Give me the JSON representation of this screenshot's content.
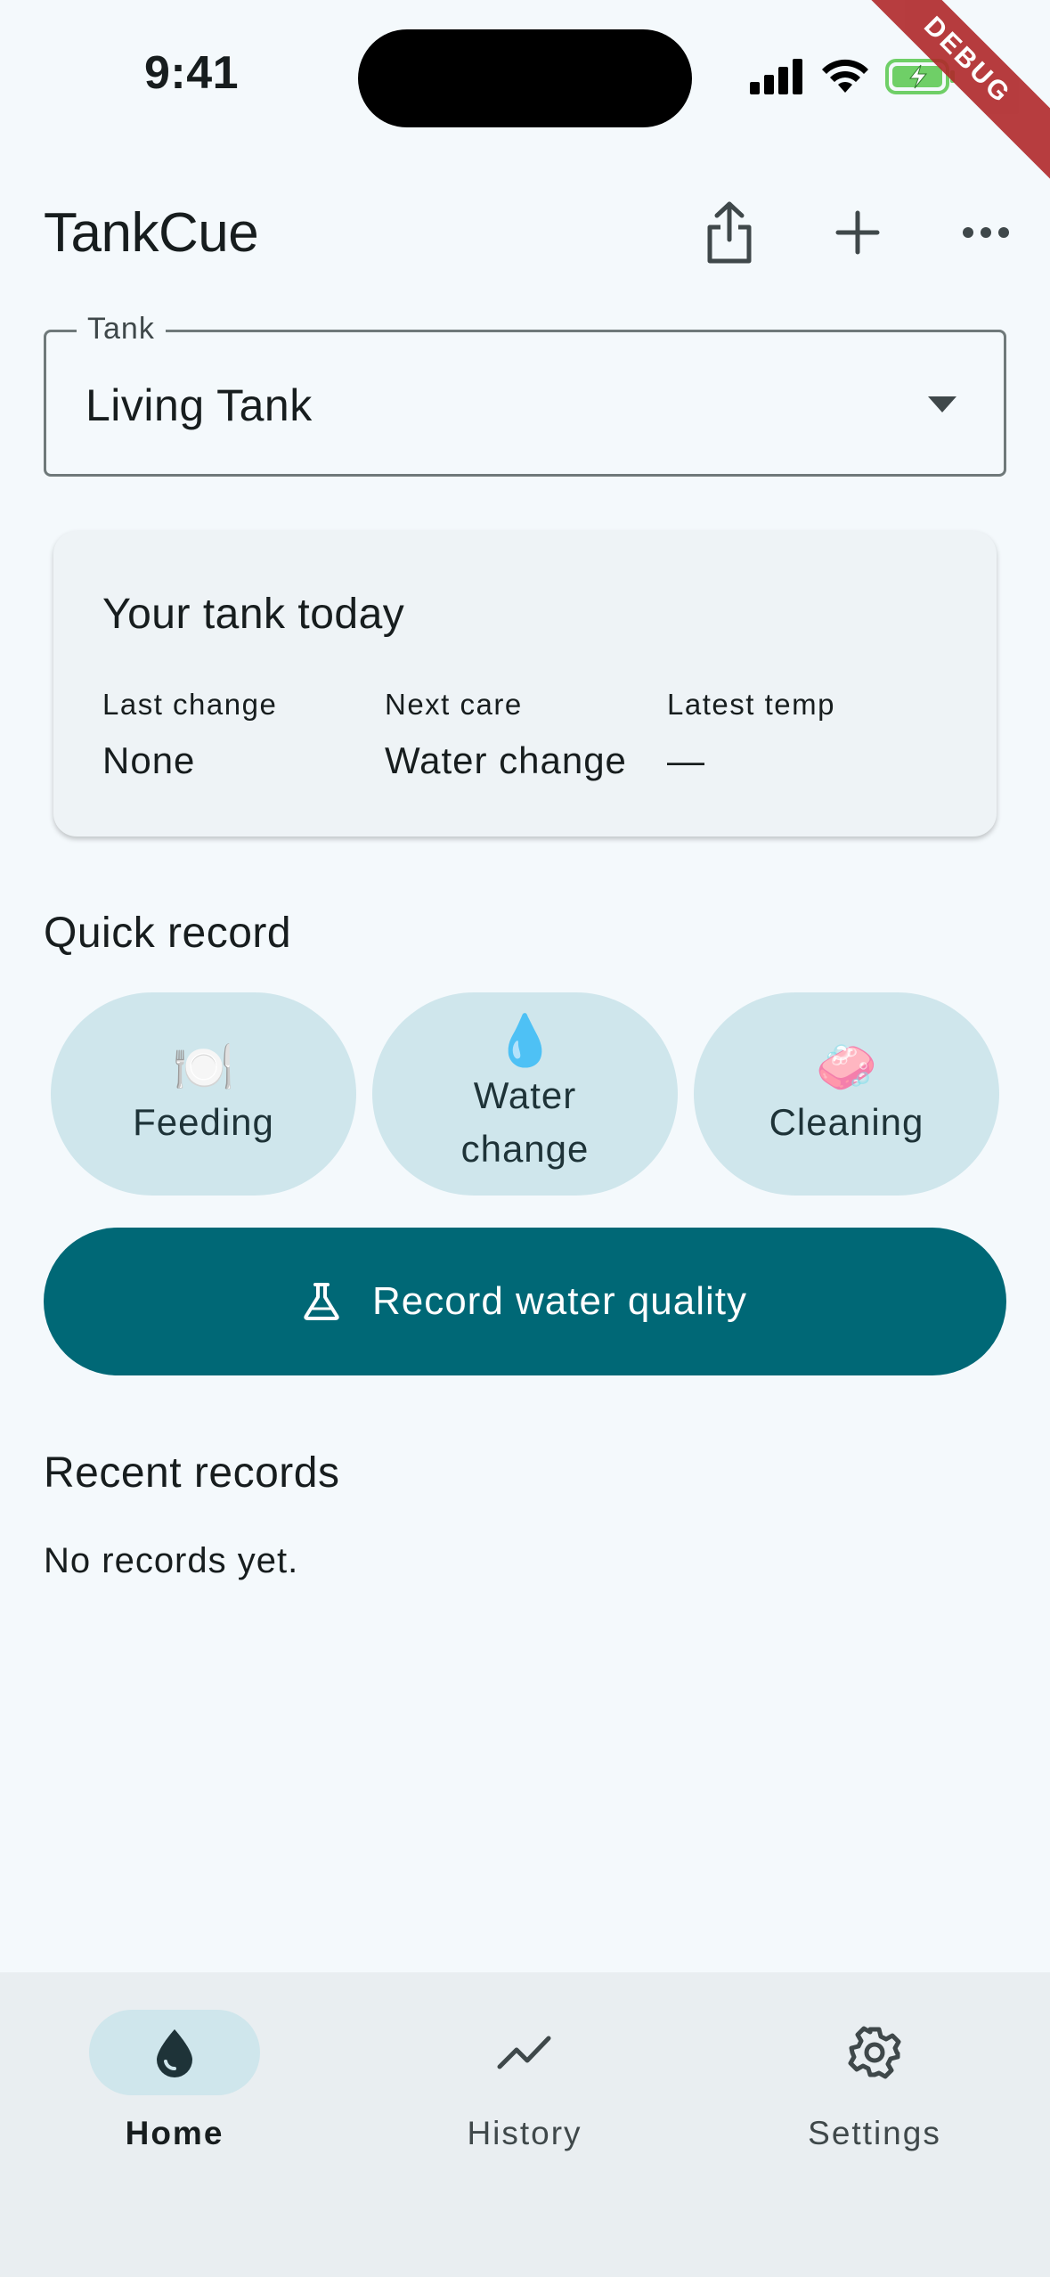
{
  "status_bar": {
    "time": "9:41",
    "debug_label": "DEBUG"
  },
  "app_bar": {
    "title": "TankCue",
    "actions": [
      "share-icon",
      "add-icon",
      "more-icon"
    ]
  },
  "tank_selector": {
    "label": "Tank",
    "value": "Living Tank"
  },
  "summary": {
    "title": "Your tank today",
    "stats": [
      {
        "label": "Last change",
        "value": "None"
      },
      {
        "label": "Next care",
        "value": "Water change"
      },
      {
        "label": "Latest temp",
        "value": "—"
      }
    ]
  },
  "quick_record": {
    "title": "Quick record",
    "buttons": [
      {
        "emoji": "🍽️",
        "label": "Feeding"
      },
      {
        "emoji": "💧",
        "label": "Water change"
      },
      {
        "emoji": "🧼",
        "label": "Cleaning"
      }
    ],
    "water_quality_label": "Record water quality"
  },
  "recent": {
    "title": "Recent records",
    "empty": "No records yet."
  },
  "nav": {
    "items": [
      {
        "label": "Home",
        "icon": "water-drop-icon",
        "active": true
      },
      {
        "label": "History",
        "icon": "trend-icon",
        "active": false
      },
      {
        "label": "Settings",
        "icon": "gear-icon",
        "active": false
      }
    ]
  },
  "colors": {
    "background": "#f4f9fc",
    "primary": "#006876",
    "tonal": "#cfe6ec",
    "nav_background": "#e9eef1"
  }
}
